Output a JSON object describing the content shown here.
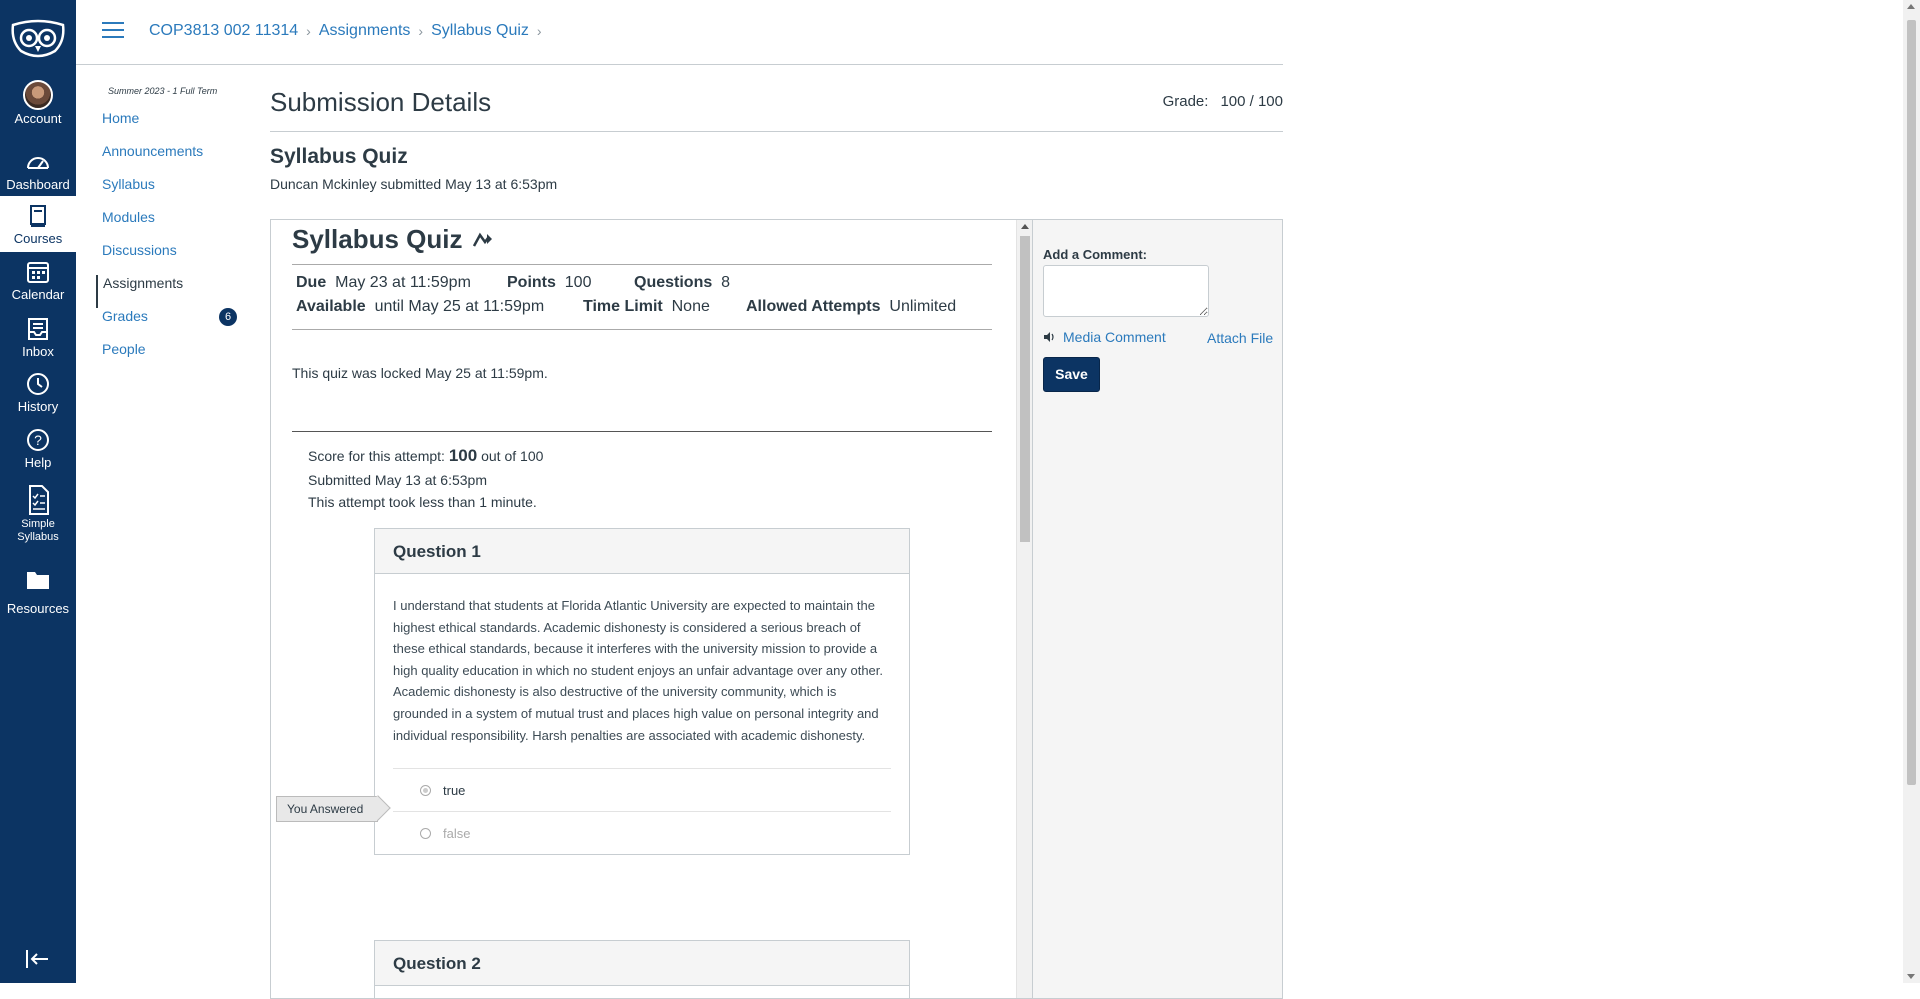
{
  "global_nav": {
    "logo": "owl-logo",
    "items": [
      {
        "label": "Account",
        "icon": "avatar"
      },
      {
        "label": "Dashboard",
        "icon": "dashboard-icon"
      },
      {
        "label": "Courses",
        "icon": "book-icon"
      },
      {
        "label": "Calendar",
        "icon": "calendar-icon"
      },
      {
        "label": "Inbox",
        "icon": "inbox-icon"
      },
      {
        "label": "History",
        "icon": "clock-icon"
      },
      {
        "label": "Help",
        "icon": "help-icon"
      },
      {
        "label": "Simple Syllabus",
        "label_line1": "Simple",
        "label_line2": "Syllabus",
        "icon": "document-icon"
      },
      {
        "label": "Resources",
        "icon": "folder-icon"
      }
    ],
    "active": "Courses",
    "colors": {
      "nav_bg": "#0c3463",
      "link": "#2b7abc"
    }
  },
  "breadcrumbs": [
    "COP3813 002 11314",
    "Assignments",
    "Syllabus Quiz"
  ],
  "course_nav": {
    "term": "Summer 2023 - 1 Full Term",
    "items": [
      {
        "label": "Home"
      },
      {
        "label": "Announcements"
      },
      {
        "label": "Syllabus"
      },
      {
        "label": "Modules"
      },
      {
        "label": "Discussions"
      },
      {
        "label": "Assignments"
      },
      {
        "label": "Grades",
        "badge": "6"
      },
      {
        "label": "People"
      }
    ],
    "active": "Assignments"
  },
  "submission": {
    "heading": "Submission Details",
    "grade_label": "Grade:",
    "grade_value": "100 / 100",
    "assignment_title": "Syllabus Quiz",
    "submitted_line": "Duncan Mckinley submitted May 13 at 6:53pm"
  },
  "quiz": {
    "title": "Syllabus Quiz",
    "due_label": "Due",
    "due_value": "May 23 at 11:59pm",
    "points_label": "Points",
    "points_value": "100",
    "questions_label": "Questions",
    "questions_value": "8",
    "available_label": "Available",
    "available_value": "until May 25 at 11:59pm",
    "time_limit_label": "Time Limit",
    "time_limit_value": "None",
    "attempts_label": "Allowed Attempts",
    "attempts_value": "Unlimited",
    "locked_text": "This quiz was locked May 25 at 11:59pm.",
    "score_prefix": "Score for this attempt:",
    "score_value": "100",
    "score_suffix": "out of 100",
    "submitted_text": "Submitted May 13 at 6:53pm",
    "duration_text": "This attempt took less than 1 minute.",
    "questions": [
      {
        "title": "Question 1",
        "text": "I understand that students at Florida Atlantic University are expected to maintain the highest ethical standards. Academic dishonesty is considered a serious breach of these ethical standards, because it interferes with the university mission to provide a high quality education in which no student enjoys an unfair advantage over any other. Academic dishonesty is also destructive of the university community, which is grounded in a system of mutual trust and places high value on personal integrity and individual responsibility. Harsh penalties are associated with academic dishonesty.",
        "answers": [
          "true",
          "false"
        ],
        "selected": "true",
        "you_answered_label": "You Answered"
      },
      {
        "title": "Question 2"
      }
    ]
  },
  "comments": {
    "label": "Add a Comment:",
    "media_comment": "Media Comment",
    "attach_file": "Attach File",
    "save": "Save"
  }
}
